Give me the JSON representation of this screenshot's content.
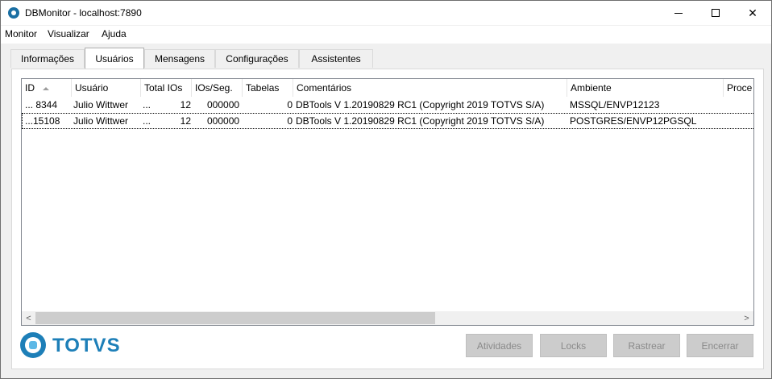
{
  "window": {
    "title": "DBMonitor - localhost:7890",
    "controls": {
      "minimize": "—",
      "maximize": "☐",
      "close": "✕"
    }
  },
  "menu": [
    "Monitor",
    "Visualizar",
    "Ajuda"
  ],
  "tabs": [
    {
      "label": "Informações",
      "active": false
    },
    {
      "label": "Usuários",
      "active": true
    },
    {
      "label": "Mensagens",
      "active": false
    },
    {
      "label": "Configurações",
      "active": false
    },
    {
      "label": "Assistentes",
      "active": false
    }
  ],
  "table": {
    "columns": [
      "ID",
      "Usuário",
      "Total IOs",
      "IOs/Seg.",
      "Tabelas",
      "Comentários",
      "Ambiente",
      "Proce"
    ],
    "sort_column": "ID",
    "rows": [
      [
        "... 8344",
        "Julio Wittwer",
        "...",
        "12",
        "000000",
        "0",
        "DBTools V 1.20190829 RC1 (Copyright 2019 TOTVS S/A)",
        "MSSQL/ENVP12123",
        ""
      ],
      [
        "...15108",
        "Julio Wittwer",
        "...",
        "12",
        "000000",
        "0",
        "DBTools V 1.20190829 RC1 (Copyright 2019 TOTVS S/A)",
        "POSTGRES/ENVP12PGSQL",
        ""
      ]
    ],
    "focused_row": 1,
    "scroll": {
      "left_arrow": "<",
      "right_arrow": ">"
    }
  },
  "logo_text": "TOTVS",
  "buttons": [
    {
      "label": "Atividades",
      "enabled": false
    },
    {
      "label": "Locks",
      "enabled": false
    },
    {
      "label": "Rastrear",
      "enabled": false
    },
    {
      "label": "Encerrar",
      "enabled": false
    }
  ],
  "colors": {
    "brand": "#1d7fb8",
    "disabled_button": "#cccccc"
  }
}
